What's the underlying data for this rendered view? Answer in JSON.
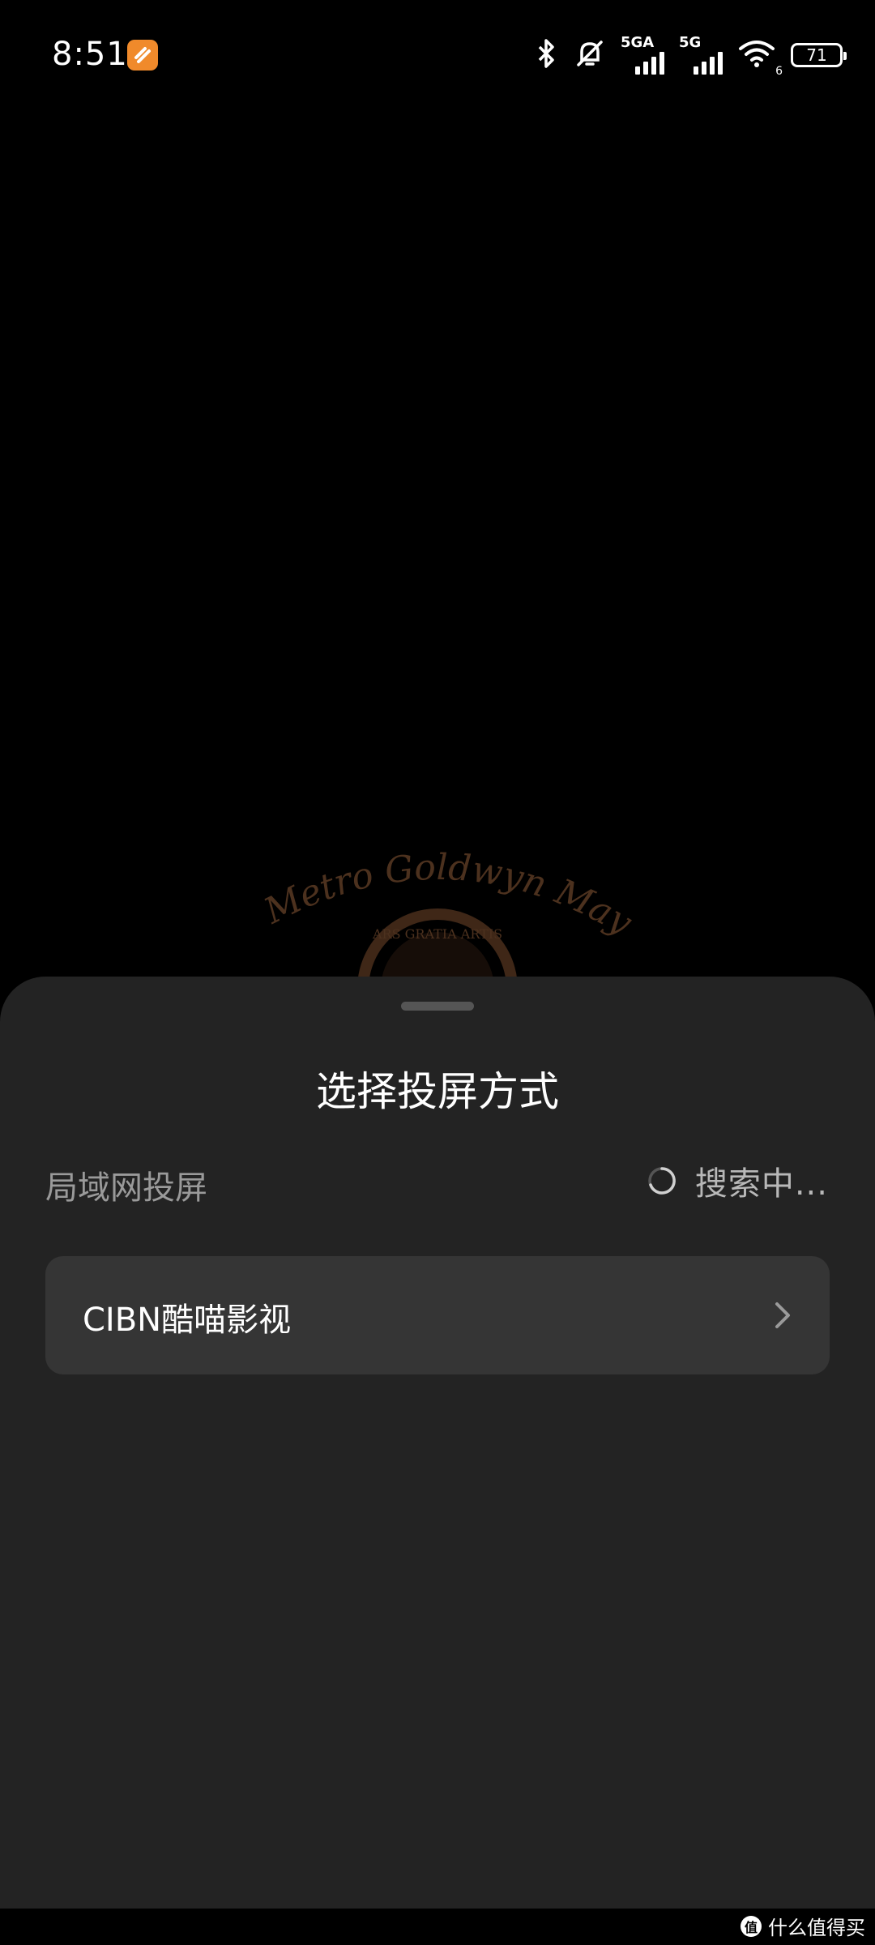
{
  "status_bar": {
    "time": "8:51",
    "app_icon": "notification-app-icon",
    "signal1_label": "5GA",
    "signal2_label": "5G",
    "wifi_badge": "6",
    "battery": "71",
    "icons": [
      "bluetooth-icon",
      "mute-bell-icon",
      "signal-icon",
      "wifi-icon",
      "battery-icon"
    ]
  },
  "background": {
    "logo_text": "Metro Goldwyn Mayer",
    "logo_ribbon": "ARS GRATIA ARTIS"
  },
  "sheet": {
    "title": "选择投屏方式",
    "section_label": "局域网投屏",
    "searching_text": "搜索中...",
    "devices": [
      {
        "name": "CIBN酷喵影视"
      }
    ]
  },
  "watermark": {
    "text": "什么值得买",
    "badge": "值"
  },
  "colors": {
    "sheet_bg": "#232323",
    "row_bg": "#353535",
    "accent_app": "#f08a2b"
  }
}
